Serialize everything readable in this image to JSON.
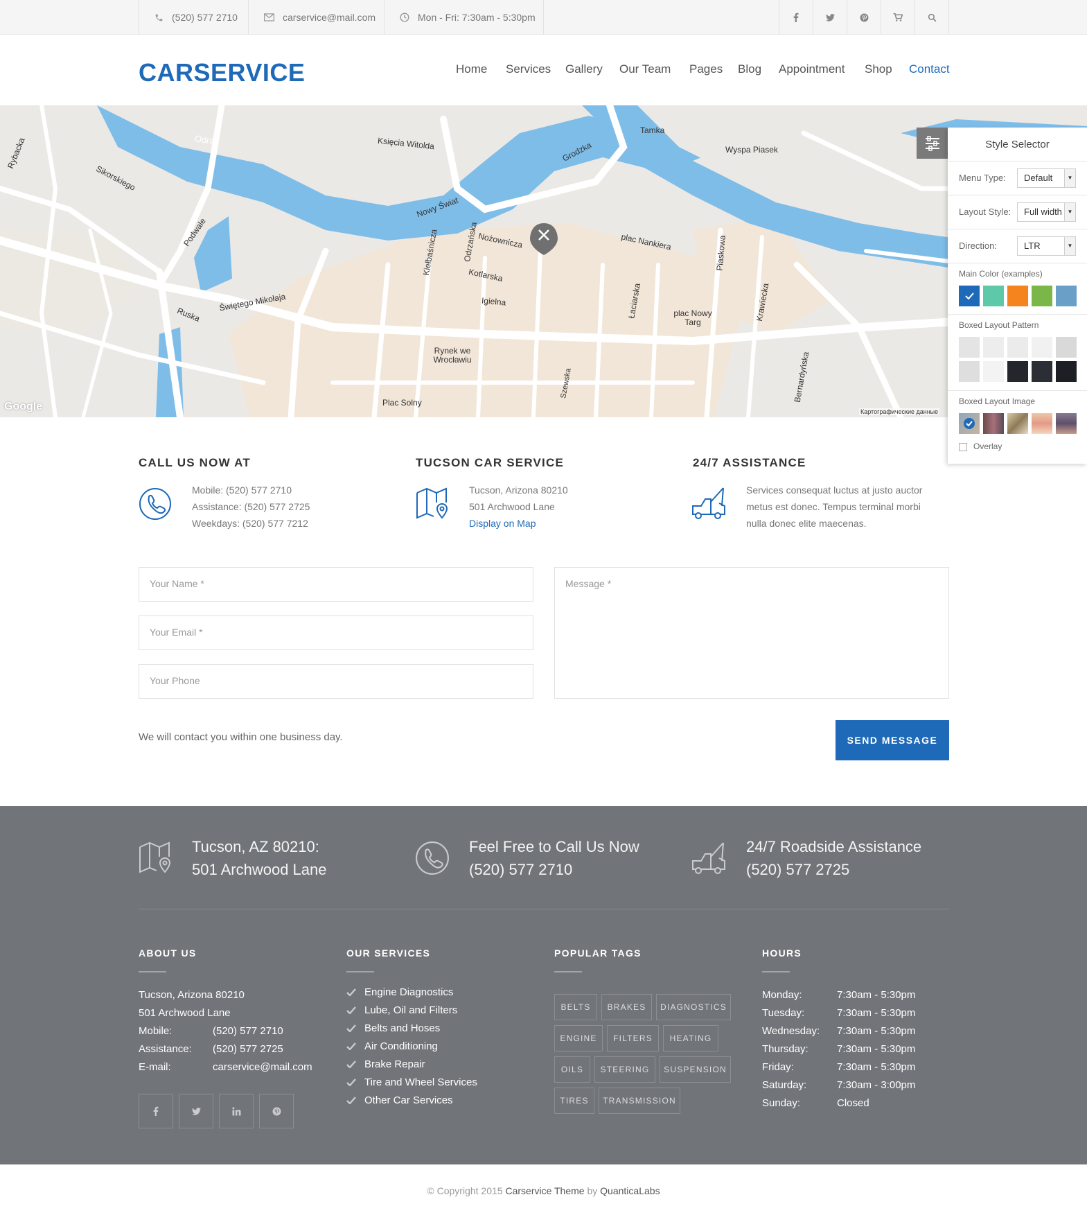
{
  "topbar": {
    "phone": "(520) 577 2710",
    "email": "carservice@mail.com",
    "hours": "Mon - Fri: 7:30am - 5:30pm",
    "icons": [
      "facebook-icon",
      "twitter-icon",
      "pinterest-icon",
      "cart-icon",
      "search-icon"
    ]
  },
  "header": {
    "logo": "CARSERVICE",
    "nav": [
      "Home",
      "Services",
      "Gallery",
      "Our Team",
      "Pages",
      "Blog",
      "Appointment",
      "Shop",
      "Contact"
    ],
    "active": "Contact"
  },
  "map": {
    "labels": [
      "Odra",
      "Księcia Witolda",
      "Wyspa Piasek",
      "Tamka",
      "Grodzka",
      "Nowy Świat",
      "Kotlarska",
      "Igielna",
      "Ruska",
      "Świętego Mikołaja",
      "Rynek we Wrocławiu",
      "plac Nowy Targ",
      "Plac Solny",
      "plac Nankiera",
      "Szewska",
      "Sikorskiego",
      "Rybacka",
      "Podwale",
      "Nożownicza",
      "Odrzańska",
      "Kiełbaśnicza",
      "Piaskowa",
      "Krawiecka",
      "Łaciarska",
      "Bernardyńska"
    ],
    "google": "Google",
    "attribution": "Картографические данные"
  },
  "style_selector": {
    "title": "Style Selector",
    "menu_type_label": "Menu Type:",
    "menu_type_value": "Default",
    "layout_style_label": "Layout Style:",
    "layout_style_value": "Full width",
    "direction_label": "Direction:",
    "direction_value": "LTR",
    "main_color_label": "Main Color (examples)",
    "colors": [
      "#1e69b8",
      "#5dc9a8",
      "#f5841f",
      "#7ab648",
      "#6a9fc7"
    ],
    "pattern_label": "Boxed Layout Pattern",
    "image_label": "Boxed Layout Image",
    "overlay_label": "Overlay"
  },
  "info": {
    "call": {
      "title": "CALL US NOW AT",
      "lines": [
        "Mobile: (520) 577 2710",
        "Assistance: (520) 577 2725",
        "Weekdays: (520) 577 7212"
      ]
    },
    "location": {
      "title": "TUCSON CAR SERVICE",
      "lines": [
        "Tucson, Arizona 80210",
        "501 Archwood Lane"
      ],
      "link": "Display on Map"
    },
    "assistance": {
      "title": "24/7 ASSISTANCE",
      "lines": [
        "Services consequat luctus at justo auctor",
        "metus est donec. Tempus terminal morbi",
        "nulla donec elite maecenas."
      ]
    }
  },
  "form": {
    "name_placeholder": "Your Name *",
    "email_placeholder": "Your Email *",
    "phone_placeholder": "Your Phone",
    "message_placeholder": "Message *",
    "note": "We will contact you within one business day.",
    "send_label": "SEND MESSAGE"
  },
  "footer": {
    "top": [
      {
        "line1": "Tucson, AZ 80210:",
        "line2": "501 Archwood Lane"
      },
      {
        "line1": "Feel Free to Call Us Now",
        "line2": "(520) 577 2710"
      },
      {
        "line1": "24/7 Roadside Assistance",
        "line2": "(520) 577 2725"
      }
    ],
    "about": {
      "title": "ABOUT US",
      "address1": "Tucson, Arizona 80210",
      "address2": "501 Archwood Lane",
      "mobile_label": "Mobile:",
      "mobile": "(520) 577 2710",
      "assistance_label": "Assistance:",
      "assistance": "(520) 577 2725",
      "email_label": "E-mail:",
      "email": "carservice@mail.com"
    },
    "services": {
      "title": "OUR SERVICES",
      "items": [
        "Engine Diagnostics",
        "Lube, Oil and Filters",
        "Belts and Hoses",
        "Air Conditioning",
        "Brake Repair",
        "Tire and Wheel Services",
        "Other Car Services"
      ]
    },
    "tags": {
      "title": "POPULAR TAGS",
      "items": [
        "BELTS",
        "BRAKES",
        "DIAGNOSTICS",
        "ENGINE",
        "FILTERS",
        "HEATING",
        "OILS",
        "STEERING",
        "SUSPENSION",
        "TIRES",
        "TRANSMISSION"
      ]
    },
    "hours": {
      "title": "HOURS",
      "rows": [
        {
          "day": "Monday:",
          "time": "7:30am - 5:30pm"
        },
        {
          "day": "Tuesday:",
          "time": "7:30am - 5:30pm"
        },
        {
          "day": "Wednesday:",
          "time": "7:30am - 5:30pm"
        },
        {
          "day": "Thursday:",
          "time": "7:30am - 5:30pm"
        },
        {
          "day": "Friday:",
          "time": "7:30am - 5:30pm"
        },
        {
          "day": "Saturday:",
          "time": "7:30am - 3:00pm"
        },
        {
          "day": "Sunday:",
          "time": "Closed"
        }
      ]
    }
  },
  "copyright": {
    "prefix": "© Copyright 2015",
    "theme": "Carservice Theme",
    "by": "by",
    "author": "QuanticaLabs"
  }
}
